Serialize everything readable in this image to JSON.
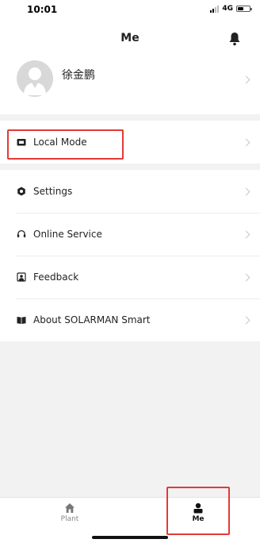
{
  "status_bar": {
    "time": "10:01",
    "network": "4G",
    "battery_level": 0.5
  },
  "header": {
    "title": "Me"
  },
  "profile": {
    "name": "徐金鹏"
  },
  "menu": {
    "local_mode": "Local Mode",
    "items": [
      {
        "label": "Settings",
        "icon": "gear-icon"
      },
      {
        "label": "Online Service",
        "icon": "headset-icon"
      },
      {
        "label": "Feedback",
        "icon": "feedback-icon"
      },
      {
        "label": "About SOLARMAN Smart",
        "icon": "book-icon"
      }
    ]
  },
  "tabbar": {
    "tabs": [
      {
        "label": "Plant",
        "icon": "home-icon",
        "active": false
      },
      {
        "label": "Me",
        "icon": "person-icon",
        "active": true
      }
    ]
  },
  "colors": {
    "highlight": "#e53935",
    "background": "#ffffff",
    "separator": "#f2f2f2",
    "text": "#222222",
    "inactive": "#888888"
  }
}
